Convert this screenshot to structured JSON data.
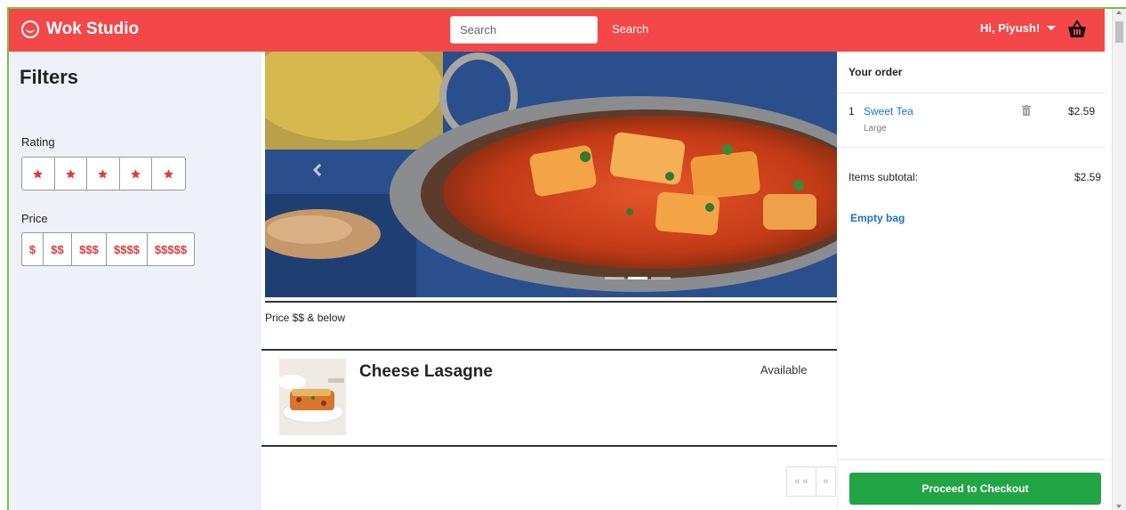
{
  "header": {
    "brand": "Wok Studio",
    "search_placeholder": "Search",
    "search_button": "Search",
    "greeting": "Hi, Piyush!",
    "accent_color": "#f44749"
  },
  "filters": {
    "title": "Filters",
    "rating_label": "Rating",
    "rating_stars": 5,
    "price_label": "Price",
    "price_options": [
      "$",
      "$$",
      "$$$",
      "$$$$",
      "$$$$$"
    ]
  },
  "carousel": {
    "slides": 3,
    "active_slide": 2
  },
  "listing": {
    "price_note": "Price $$ & below",
    "dish": {
      "name": "Cheese Lasagne",
      "status": "Available"
    },
    "pager": [
      "« «",
      "«"
    ]
  },
  "order": {
    "title": "Your order",
    "items": [
      {
        "qty": "1",
        "name": "Sweet Tea",
        "size": "Large",
        "price": "$2.59"
      }
    ],
    "subtotal_label": "Items subtotal:",
    "subtotal_value": "$2.59",
    "empty_bag": "Empty bag",
    "checkout": "Proceed to Checkout",
    "checkout_color": "#22a546"
  }
}
